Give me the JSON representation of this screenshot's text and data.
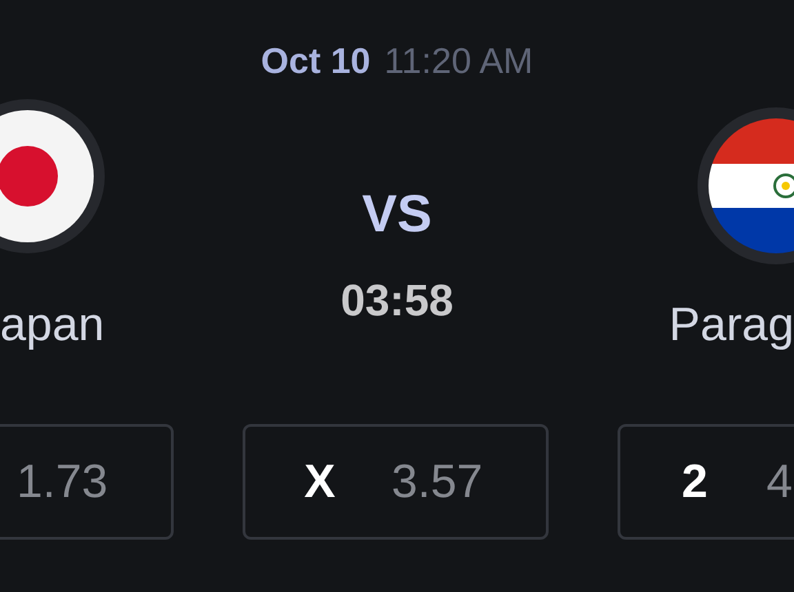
{
  "match": {
    "date": "Oct 10",
    "time": "11:20 AM",
    "vs": "VS",
    "countdown": "03:58"
  },
  "teams": [
    {
      "name": "apan",
      "kind": "japan"
    },
    {
      "name": "Parag",
      "kind": "paraguay"
    }
  ],
  "odds": [
    {
      "value": "1.73"
    },
    {
      "label": "X",
      "value": "3.57"
    },
    {
      "label": "2",
      "value": "4"
    }
  ]
}
